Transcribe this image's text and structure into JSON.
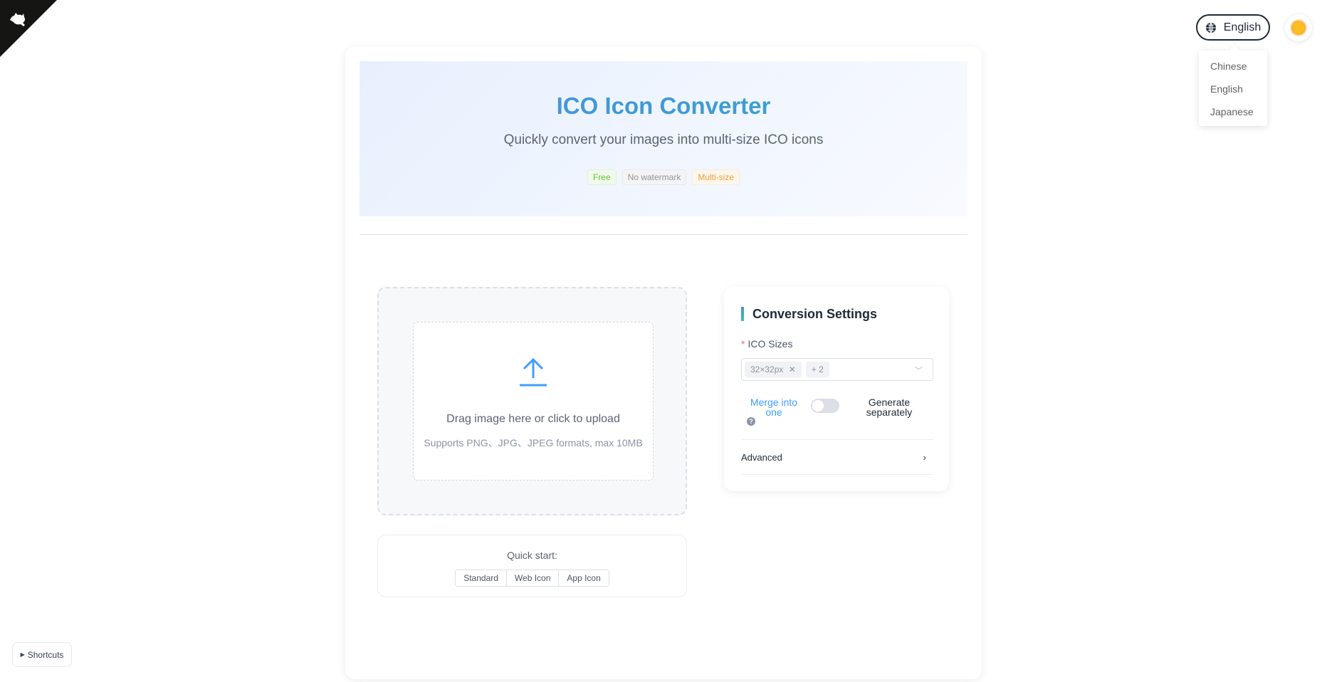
{
  "language": {
    "current": "English",
    "options": [
      "Chinese",
      "English",
      "Japanese"
    ]
  },
  "hero": {
    "title": "ICO Icon Converter",
    "subtitle": "Quickly convert your images into multi-size ICO icons",
    "tags": [
      {
        "label": "Free",
        "color": "#67c23a"
      },
      {
        "label": "No watermark",
        "color": "#909399"
      },
      {
        "label": "Multi-size",
        "color": "#e6a23c"
      }
    ]
  },
  "upload": {
    "prompt": "Drag image here or click to upload",
    "hint": "Supports PNG、JPG、JPEG formats, max 10MB"
  },
  "quick_start": {
    "label": "Quick start:",
    "buttons": [
      "Standard",
      "Web Icon",
      "App Icon"
    ]
  },
  "settings": {
    "title": "Conversion Settings",
    "sizes_label": "ICO Sizes",
    "required_mark": "*",
    "selected_size": "32×32px",
    "more_count": "+ 2",
    "merge_label": "Merge into one",
    "help": "?",
    "separate_label": "Generate separately",
    "advanced_label": "Advanced"
  },
  "shortcuts_label": "Shortcuts"
}
